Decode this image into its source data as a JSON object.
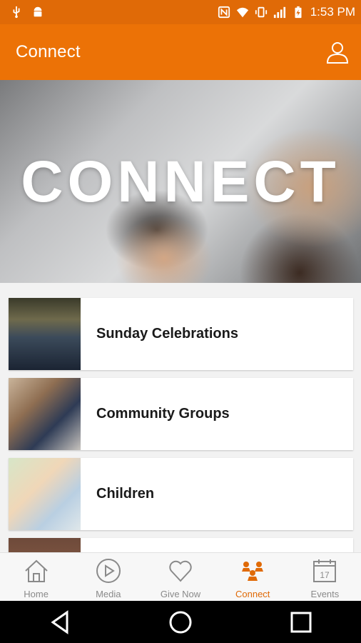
{
  "status_bar": {
    "time": "1:53 PM",
    "icons": [
      "usb-icon",
      "android-icon",
      "nfc-icon",
      "wifi-icon",
      "vibrate-icon",
      "signal-icon",
      "battery-charging-icon"
    ]
  },
  "app_bar": {
    "title": "Connect",
    "action_icon": "user-icon"
  },
  "hero": {
    "text": "CONNECT"
  },
  "list": {
    "items": [
      {
        "label": "Sunday Celebrations"
      },
      {
        "label": "Community Groups"
      },
      {
        "label": "Children"
      },
      {
        "label": ""
      }
    ]
  },
  "bottom_nav": {
    "items": [
      {
        "label": "Home",
        "icon": "home-icon"
      },
      {
        "label": "Media",
        "icon": "play-icon"
      },
      {
        "label": "Give Now",
        "icon": "heart-icon"
      },
      {
        "label": "Connect",
        "icon": "people-icon",
        "active": true
      },
      {
        "label": "Events",
        "icon": "calendar-icon",
        "day": "17"
      }
    ]
  },
  "colors": {
    "accent": "#ec7206",
    "status_bar": "#e06a07",
    "inactive": "#8a8a8a"
  }
}
